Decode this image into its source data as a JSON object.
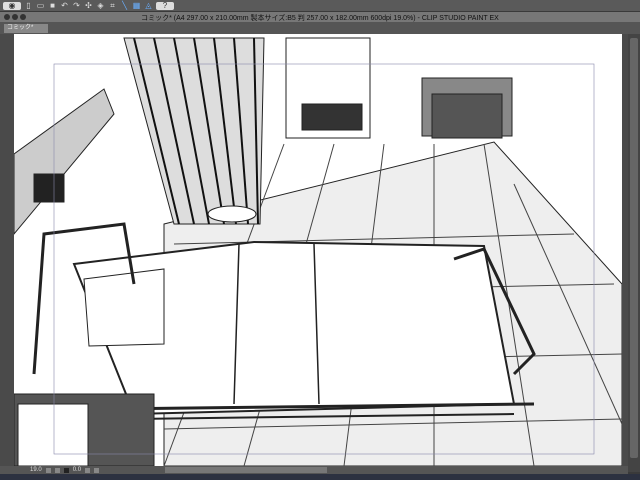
{
  "toolbar": {
    "icons": [
      "app-menu-icon",
      "new-icon",
      "open-icon",
      "save-icon",
      "undo-icon",
      "redo-icon",
      "transform-icon",
      "fill-icon",
      "select-icon",
      "snap-ruler-icon",
      "snap-grid-icon",
      "snap-perspective-icon",
      "help-icon"
    ]
  },
  "window": {
    "title": "コミック* (A4 297.00 x 210.00mm 製本サイズ:B5 判 257.00 x 182.00mm 600dpi 19.0%) - CLIP STUDIO PAINT EX"
  },
  "tab": {
    "label": "コミック*"
  },
  "status": {
    "zoom": "19.0",
    "rotation": "0.0"
  }
}
